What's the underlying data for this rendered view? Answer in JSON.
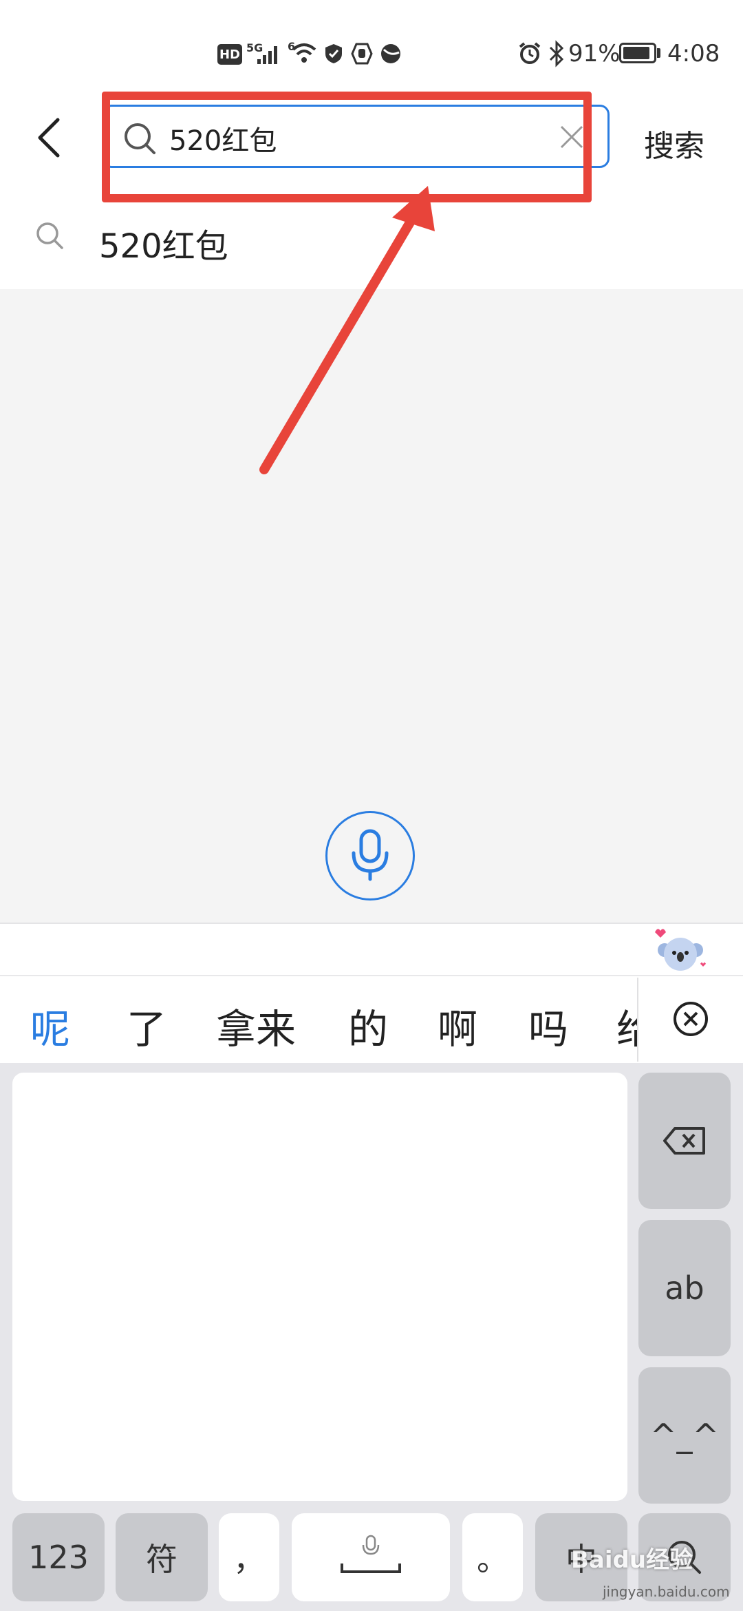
{
  "status_bar": {
    "hd": "HD",
    "network": "5G",
    "wifi_badge": "6",
    "battery_percent": "91%",
    "battery_level": 0.91,
    "time": "4:08"
  },
  "header": {
    "search_value": "520红包",
    "search_button": "搜索"
  },
  "suggestions": [
    {
      "text": "520红包"
    }
  ],
  "ime": {
    "candidates": [
      "呢",
      "了",
      "拿来",
      "的",
      "啊",
      "吗",
      "给"
    ],
    "keys": {
      "backspace_icon": "backspace-icon",
      "ab": "ab",
      "kaomoji": "^_^",
      "num": "123",
      "symbol": "符",
      "comma": "，",
      "period": "。",
      "lang": "中",
      "search_icon": "search-icon"
    }
  },
  "watermark": {
    "brand": "Baidu经验",
    "domain": "jingyan.baidu.com"
  },
  "colors": {
    "accent": "#2a7de1",
    "annotation": "#e8443a",
    "highlight_candidate": "#2a7de1"
  }
}
